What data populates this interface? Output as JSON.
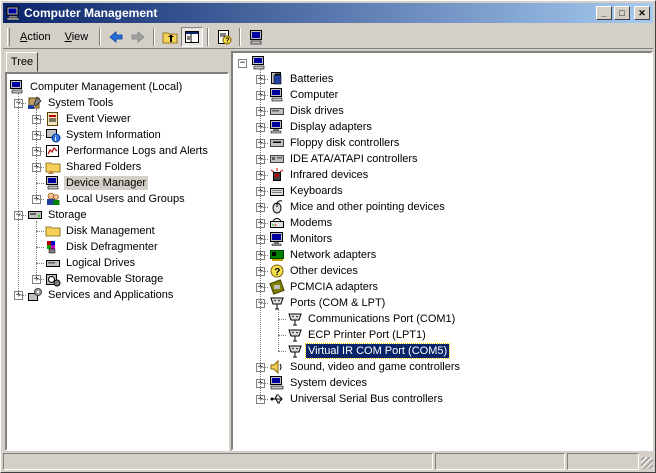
{
  "window": {
    "title": "Computer Management",
    "controls": {
      "minimize": "_",
      "maximize": "□",
      "close": "✕"
    }
  },
  "toolbar": {
    "menus": [
      {
        "label": "Action",
        "accel": "A",
        "rest": "ction"
      },
      {
        "label": "View",
        "accel": "V",
        "rest": "iew"
      }
    ],
    "buttons": [
      "back-arrow-icon",
      "forward-arrow-icon",
      "up-folder-icon",
      "show-hide-tree-icon",
      "properties-help-icon",
      "device-manager-tool-icon"
    ]
  },
  "left_tab": {
    "label": "Tree"
  },
  "left_tree": [
    {
      "label": "Computer Management (Local)",
      "level": 0,
      "icon": "computer-management-icon",
      "expander": "none"
    },
    {
      "label": "System Tools",
      "level": 1,
      "icon": "system-tools-icon",
      "expander": "minus"
    },
    {
      "label": "Event Viewer",
      "level": 2,
      "icon": "event-viewer-icon",
      "expander": "plus"
    },
    {
      "label": "System Information",
      "level": 2,
      "icon": "system-information-icon",
      "expander": "plus"
    },
    {
      "label": "Performance Logs and Alerts",
      "level": 2,
      "icon": "performance-logs-icon",
      "expander": "plus"
    },
    {
      "label": "Shared Folders",
      "level": 2,
      "icon": "shared-folders-icon",
      "expander": "plus"
    },
    {
      "label": "Device Manager",
      "level": 2,
      "icon": "device-manager-icon",
      "expander": "none",
      "selected": "grey"
    },
    {
      "label": "Local Users and Groups",
      "level": 2,
      "icon": "local-users-icon",
      "expander": "plus"
    },
    {
      "label": "Storage",
      "level": 1,
      "icon": "storage-icon",
      "expander": "minus"
    },
    {
      "label": "Disk Management",
      "level": 2,
      "icon": "disk-management-icon",
      "expander": "none"
    },
    {
      "label": "Disk Defragmenter",
      "level": 2,
      "icon": "disk-defragmenter-icon",
      "expander": "none"
    },
    {
      "label": "Logical Drives",
      "level": 2,
      "icon": "logical-drives-icon",
      "expander": "none"
    },
    {
      "label": "Removable Storage",
      "level": 2,
      "icon": "removable-storage-icon",
      "expander": "plus"
    },
    {
      "label": "Services and Applications",
      "level": 1,
      "icon": "services-applications-icon",
      "expander": "plus"
    }
  ],
  "right_tree": [
    {
      "label": "",
      "level": 0,
      "icon": "computer-icon",
      "expander": "minus"
    },
    {
      "label": "Batteries",
      "level": 1,
      "icon": "batteries-icon",
      "expander": "plus"
    },
    {
      "label": "Computer",
      "level": 1,
      "icon": "computer-icon",
      "expander": "plus"
    },
    {
      "label": "Disk drives",
      "level": 1,
      "icon": "disk-drive-icon",
      "expander": "plus"
    },
    {
      "label": "Display adapters",
      "level": 1,
      "icon": "display-adapter-icon",
      "expander": "plus"
    },
    {
      "label": "Floppy disk controllers",
      "level": 1,
      "icon": "floppy-controller-icon",
      "expander": "plus"
    },
    {
      "label": "IDE ATA/ATAPI controllers",
      "level": 1,
      "icon": "ide-controller-icon",
      "expander": "plus"
    },
    {
      "label": "Infrared devices",
      "level": 1,
      "icon": "infrared-icon",
      "expander": "plus"
    },
    {
      "label": "Keyboards",
      "level": 1,
      "icon": "keyboard-icon",
      "expander": "plus"
    },
    {
      "label": "Mice and other pointing devices",
      "level": 1,
      "icon": "mouse-icon",
      "expander": "plus"
    },
    {
      "label": "Modems",
      "level": 1,
      "icon": "modem-icon",
      "expander": "plus"
    },
    {
      "label": "Monitors",
      "level": 1,
      "icon": "monitor-icon",
      "expander": "plus"
    },
    {
      "label": "Network adapters",
      "level": 1,
      "icon": "network-adapter-icon",
      "expander": "plus"
    },
    {
      "label": "Other devices",
      "level": 1,
      "icon": "other-devices-icon",
      "expander": "plus"
    },
    {
      "label": "PCMCIA adapters",
      "level": 1,
      "icon": "pcmcia-icon",
      "expander": "plus"
    },
    {
      "label": "Ports (COM & LPT)",
      "level": 1,
      "icon": "port-icon",
      "expander": "minus"
    },
    {
      "label": "Communications Port (COM1)",
      "level": 2,
      "icon": "port-icon",
      "expander": "none"
    },
    {
      "label": "ECP Printer Port (LPT1)",
      "level": 2,
      "icon": "port-icon",
      "expander": "none"
    },
    {
      "label": "Virtual IR COM Port (COM5)",
      "level": 2,
      "icon": "port-icon",
      "expander": "none",
      "selected": "blue"
    },
    {
      "label": "Sound, video and game controllers",
      "level": 1,
      "icon": "sound-icon",
      "expander": "plus"
    },
    {
      "label": "System devices",
      "level": 1,
      "icon": "system-devices-icon",
      "expander": "plus"
    },
    {
      "label": "Universal Serial Bus controllers",
      "level": 1,
      "icon": "usb-icon",
      "expander": "plus"
    }
  ],
  "statusbar": {
    "cells": [
      "",
      "",
      ""
    ]
  },
  "colors": {
    "title_start": "#0a246a",
    "title_end": "#a6caf0",
    "face": "#d4d0c8",
    "selection": "#0a246a"
  }
}
